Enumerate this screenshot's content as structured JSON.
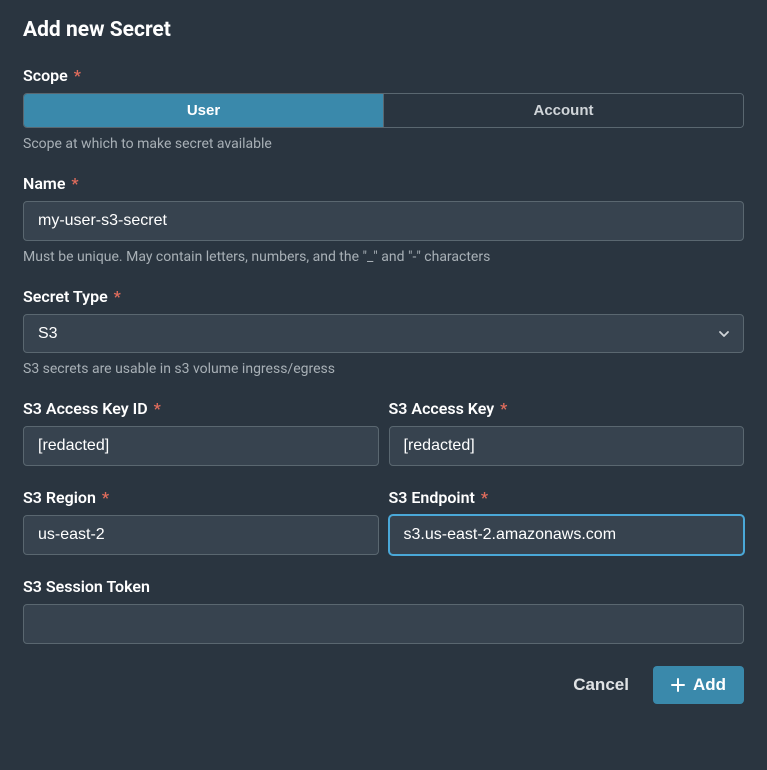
{
  "title": "Add new Secret",
  "fields": {
    "scope": {
      "label": "Scope",
      "required": true,
      "options": {
        "user": "User",
        "account": "Account"
      },
      "selected": "user",
      "hint": "Scope at which to make secret available"
    },
    "name": {
      "label": "Name",
      "required": true,
      "value": "my-user-s3-secret",
      "hint": "Must be unique. May contain letters, numbers, and the \"_\" and \"-\" characters"
    },
    "secretType": {
      "label": "Secret Type",
      "required": true,
      "value": "S3",
      "hint": "S3 secrets are usable in s3 volume ingress/egress"
    },
    "s3AccessKeyId": {
      "label": "S3 Access Key ID",
      "required": true,
      "value": "[redacted]"
    },
    "s3AccessKey": {
      "label": "S3 Access Key",
      "required": true,
      "value": "[redacted]"
    },
    "s3Region": {
      "label": "S3 Region",
      "required": true,
      "value": "us-east-2"
    },
    "s3Endpoint": {
      "label": "S3 Endpoint",
      "required": true,
      "value": "s3.us-east-2.amazonaws.com"
    },
    "s3SessionToken": {
      "label": "S3 Session Token",
      "required": false,
      "value": ""
    }
  },
  "actions": {
    "cancel": "Cancel",
    "add": "Add"
  },
  "requiredMark": "*"
}
